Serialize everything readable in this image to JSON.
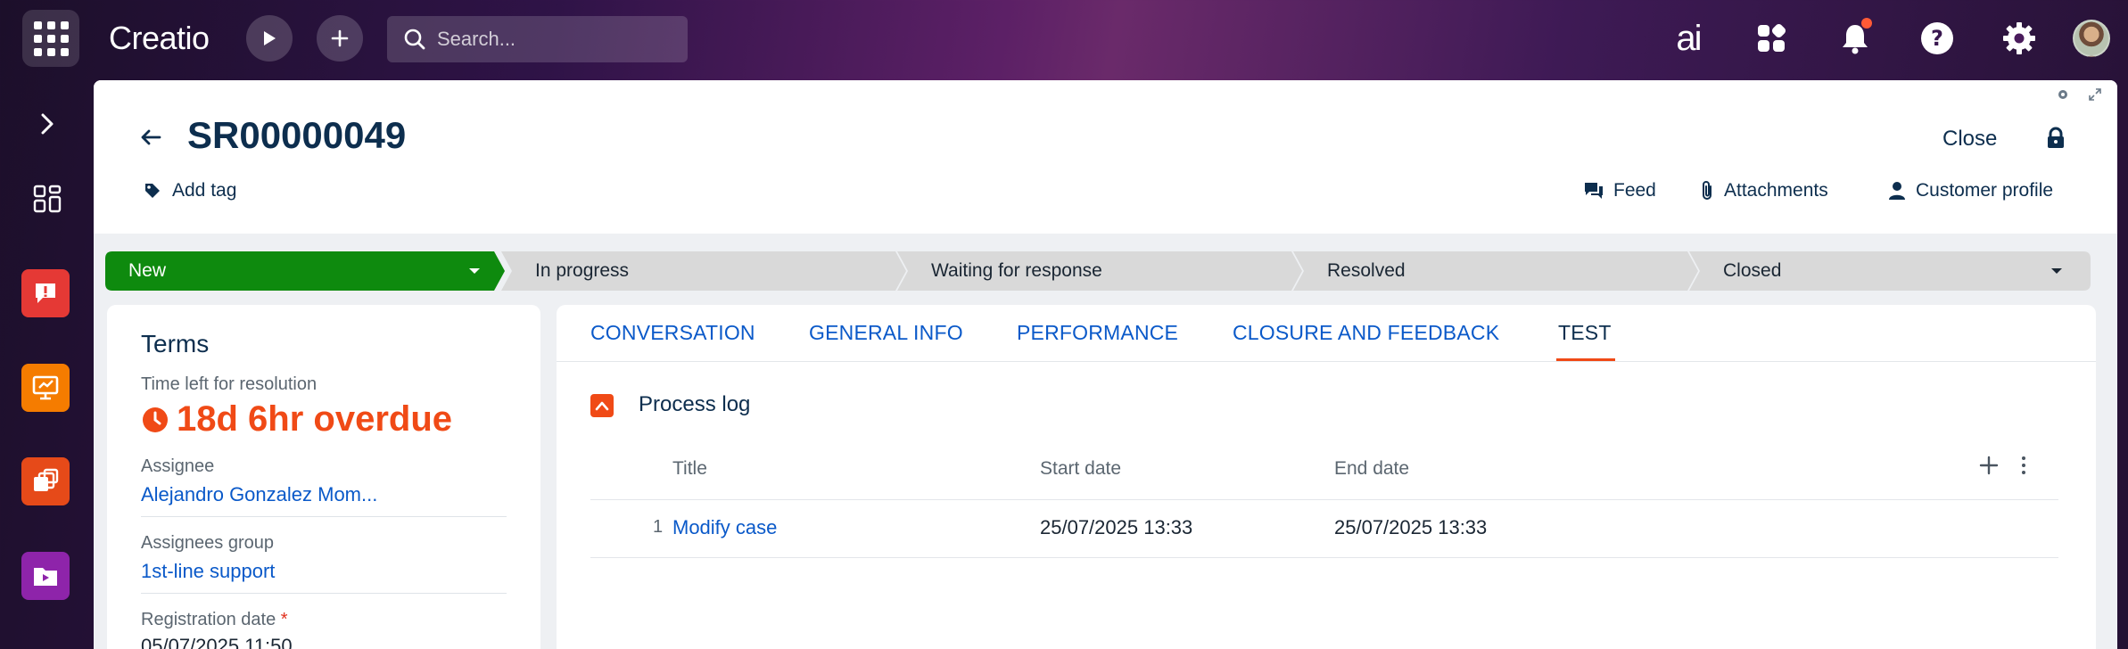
{
  "app": {
    "logo": "Creatio"
  },
  "topbar": {
    "search_placeholder": "Search...",
    "ai_label": "ai",
    "icons": [
      "apps-grid-icon",
      "play-icon",
      "plus-icon",
      "search-icon",
      "ai-icon",
      "widgets-icon",
      "bell-icon",
      "help-icon",
      "gear-icon",
      "avatar"
    ]
  },
  "sidebar": {
    "items": [
      {
        "name": "expand-chevron-icon"
      },
      {
        "name": "dashboard-icon"
      },
      {
        "name": "cases-app-icon",
        "color": "#e53935"
      },
      {
        "name": "presentation-app-icon",
        "color": "#f57c00"
      },
      {
        "name": "campaign-app-icon",
        "color": "#e64a19"
      },
      {
        "name": "folder-app-icon",
        "color": "#8e24aa"
      }
    ]
  },
  "record": {
    "title": "SR00000049",
    "add_tag": "Add tag",
    "close": "Close",
    "actions": {
      "feed": "Feed",
      "attachments": "Attachments",
      "customer_profile": "Customer profile"
    }
  },
  "stages": [
    {
      "label": "New",
      "active": true,
      "color": "#0e8a0e"
    },
    {
      "label": "In progress",
      "active": false
    },
    {
      "label": "Waiting for response",
      "active": false
    },
    {
      "label": "Resolved",
      "active": false
    },
    {
      "label": "Closed",
      "active": false
    }
  ],
  "terms": {
    "heading": "Terms",
    "time_left_label": "Time left for resolution",
    "time_left_value": "18d 6hr overdue",
    "assignee_label": "Assignee",
    "assignee_value": "Alejandro Gonzalez Mom...",
    "group_label": "Assignees group",
    "group_value": "1st-line support",
    "reg_date_label": "Registration date",
    "reg_date_required": "*",
    "reg_date_value": "05/07/2025 11:50"
  },
  "tabs": [
    {
      "label": "CONVERSATION",
      "active": false
    },
    {
      "label": "GENERAL INFO",
      "active": false
    },
    {
      "label": "PERFORMANCE",
      "active": false
    },
    {
      "label": "CLOSURE AND FEEDBACK",
      "active": false
    },
    {
      "label": "TEST",
      "active": true
    }
  ],
  "process_log": {
    "title": "Process log",
    "columns": [
      "Title",
      "Start date",
      "End date"
    ],
    "rows": [
      {
        "num": "1",
        "title": "Modify case",
        "start": "25/07/2025 13:33",
        "end": "25/07/2025 13:33"
      }
    ]
  },
  "colors": {
    "accent": "#f04a16",
    "link": "#0a59c9",
    "active_stage": "#0e8a0e",
    "title": "#0d2e4e"
  }
}
